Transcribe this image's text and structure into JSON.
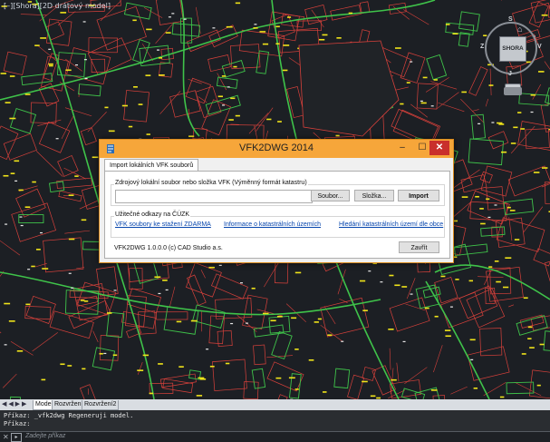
{
  "viewport": {
    "label": "[–][Shora][2D drátový model]"
  },
  "viewcube": {
    "face": "SHORA",
    "north": "S",
    "south": "J",
    "west": "Z",
    "east": "V",
    "wcs": "WCS"
  },
  "dialog": {
    "title": "VFK2DWG 2014",
    "tab": "Import lokálních VFK souborů",
    "source_group": "Zdrojový lokální soubor nebo složka VFK (Výměnný formát katastru)",
    "file_path_value": "",
    "btn_file": "Soubor...",
    "btn_folder": "Složka...",
    "btn_import": "Import",
    "links_group": "Užitečné odkazy na ČÚZK",
    "links": [
      "VFK soubory ke stažení ZDARMA",
      "Informace o katastrálních územích",
      "Hledání katastrálních území dle obce"
    ],
    "version": "VFK2DWG 1.0.0.0 (c) CAD Studio a.s.",
    "btn_close": "Zavřít",
    "colors": {
      "title_bar": "#f6a63a",
      "close_btn": "#c9302c",
      "link": "#0645ad"
    }
  },
  "layout_tabs": [
    "Model",
    "Rozvržení1",
    "Rozvržení2"
  ],
  "command": {
    "history": [
      "Příkaz: _vfk2dwg Regeneruji model.",
      "Příkaz:"
    ],
    "placeholder": "Zadejte příkaz"
  },
  "map_colors": {
    "background": "#1c1f24",
    "red": "#d8413b",
    "green": "#3fc34a",
    "yellow": "#f0e41a",
    "white": "#e8e8e8"
  }
}
